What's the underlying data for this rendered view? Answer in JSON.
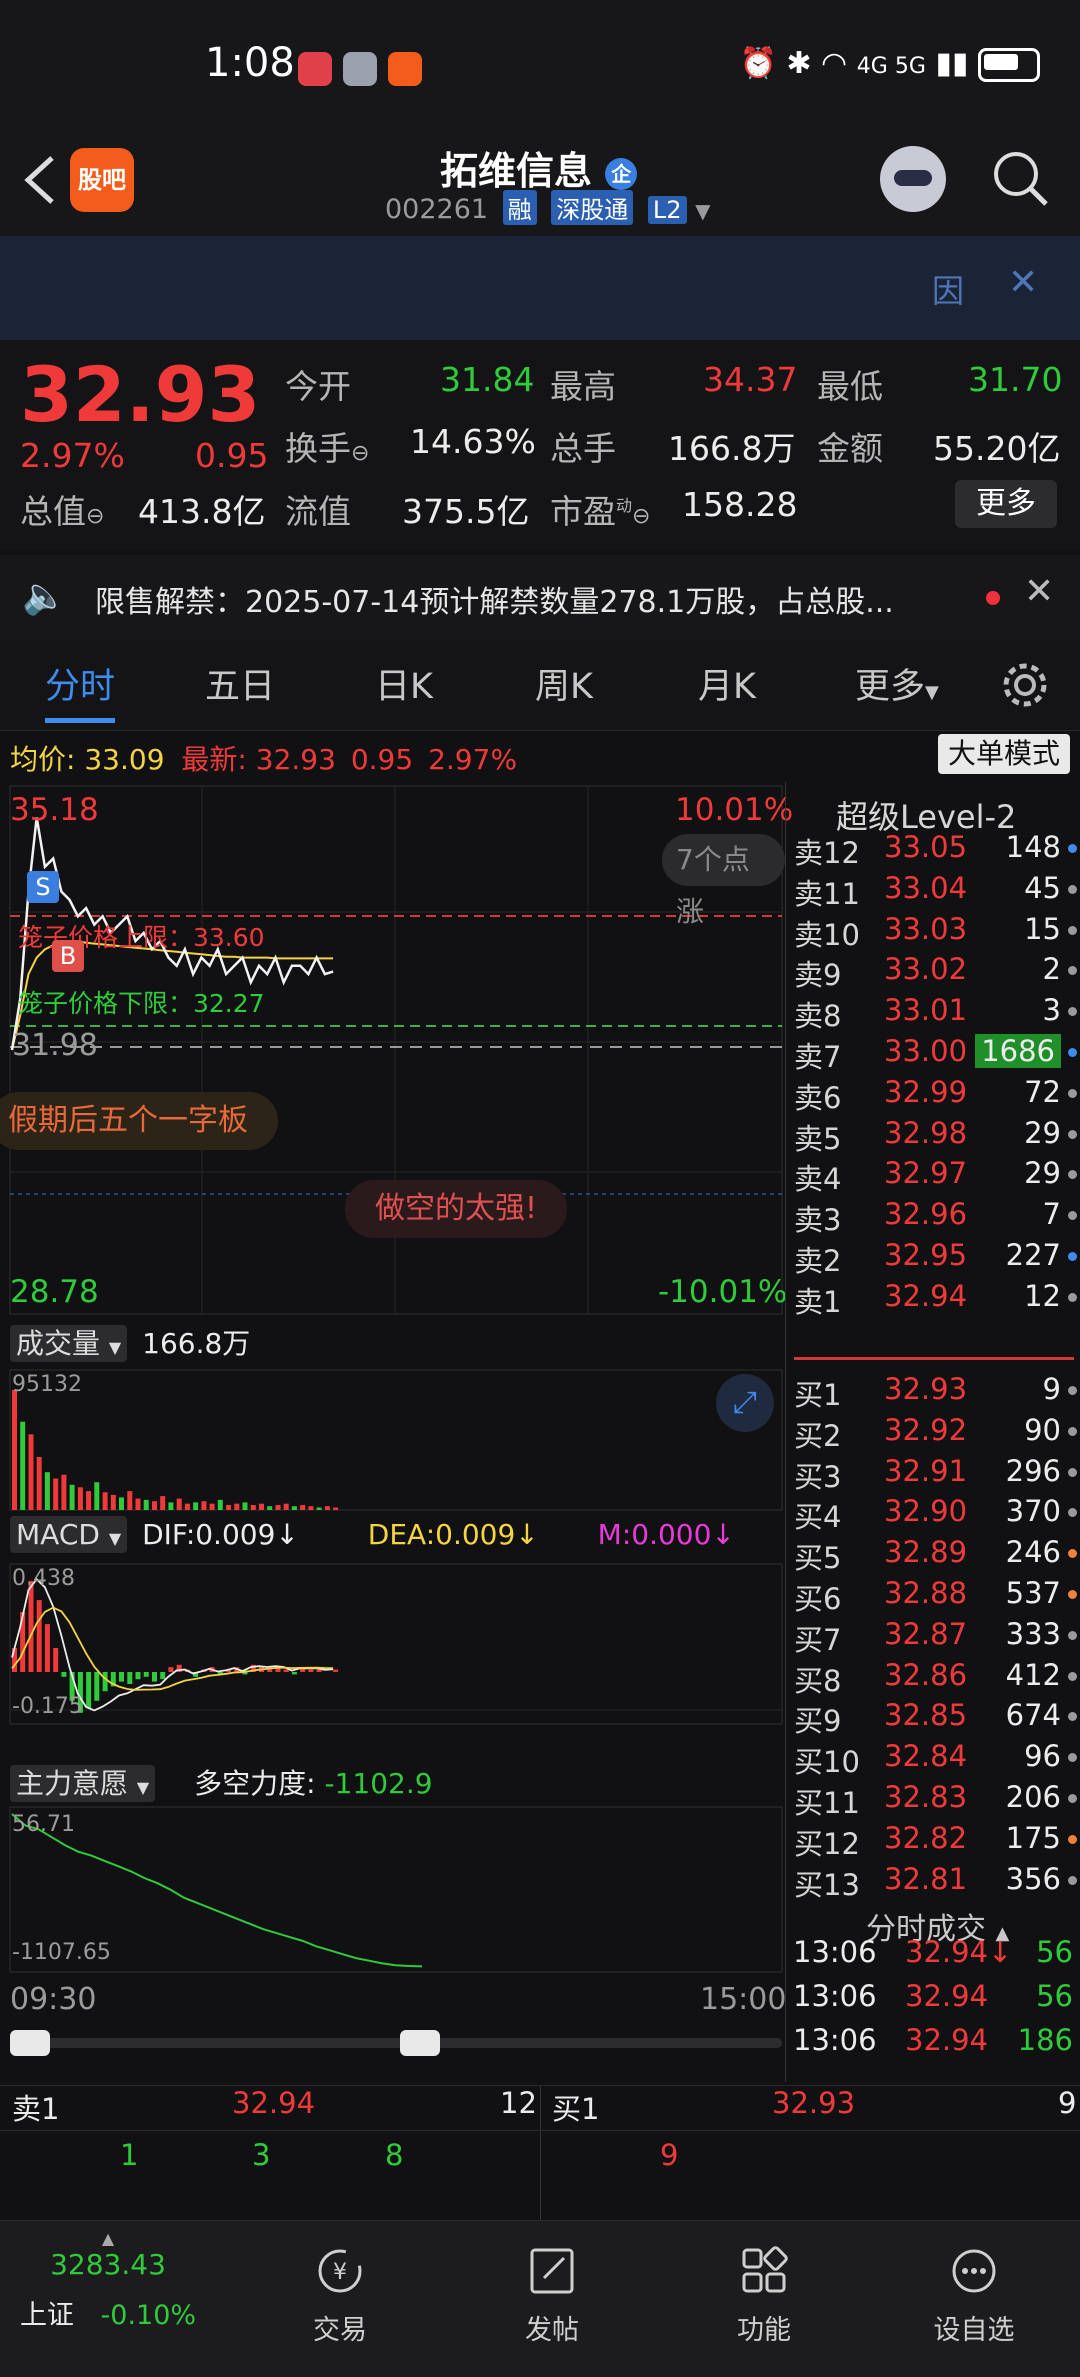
{
  "status_bar": {
    "time": "1:08",
    "network": "4G 5G"
  },
  "header": {
    "title": "拓维信息",
    "code": "002261",
    "tags": [
      "融",
      "深股通",
      "L2"
    ],
    "logo_text": "股吧"
  },
  "banner": {
    "right_char": "因"
  },
  "quote": {
    "price": "32.93",
    "change_pct": "2.97%",
    "change": "0.95",
    "fields": [
      {
        "label": "今开",
        "value": "31.84",
        "color": "green"
      },
      {
        "label": "最高",
        "value": "34.37",
        "color": "red"
      },
      {
        "label": "最低",
        "value": "31.70",
        "color": "green"
      },
      {
        "label": "换手",
        "value": "14.63%",
        "color": "white"
      },
      {
        "label": "总手",
        "value": "166.8万",
        "color": "white"
      },
      {
        "label": "金额",
        "value": "55.20亿",
        "color": "white"
      },
      {
        "label": "总值",
        "value": "413.8亿",
        "color": "white"
      },
      {
        "label": "流值",
        "value": "375.5亿",
        "color": "white"
      },
      {
        "label": "市盈",
        "value": "158.28",
        "color": "white"
      }
    ],
    "pe_superscript": "动",
    "more_label": "更多"
  },
  "notice": {
    "text": "限售解禁：2025-07-14预计解禁数量278.1万股，占总股..."
  },
  "tabs": [
    "分时",
    "五日",
    "日K",
    "周K",
    "月K",
    "更多"
  ],
  "infobar": {
    "avg_label": "均价:",
    "avg_value": "33.09",
    "latest_label": "最新:",
    "latest_value": "32.93",
    "change": "0.95",
    "change_pct": "2.97%",
    "mode_button": "大单模式"
  },
  "chart": {
    "top_price": "35.18",
    "top_pct": "10.01%",
    "bottom_price": "28.78",
    "bottom_pct": "-10.01%",
    "base_price": "31.98",
    "upper_limit_label": "笼子价格上限：33.60",
    "lower_limit_label": "笼子价格下限：32.27",
    "points_label": "7个点涨",
    "bubble1": "假期后五个一字板",
    "bubble2": "做空的太强!",
    "marker_s": "S",
    "marker_b": "B",
    "volume_label": "成交量",
    "volume_total": "166.8万",
    "volume_max": "95132",
    "macd_label": "MACD",
    "dif": "DIF:0.009↓",
    "dea": "DEA:0.009↓",
    "m": "M:0.000↓",
    "macd_top": "0.438",
    "macd_bottom": "-0.175",
    "main_label": "主力意愿",
    "force_label": "多空力度:",
    "force_value": "-1102.9",
    "main_top": "56.71",
    "main_bottom": "-1107.65",
    "time_start": "09:30",
    "time_end": "15:00",
    "price_line": [
      31.98,
      32.6,
      33.9,
      34.8,
      34.2,
      34.3,
      33.9,
      33.8,
      33.6,
      33.7,
      33.5,
      33.6,
      33.4,
      33.5,
      33.6,
      33.3,
      33.4,
      33.2,
      33.3,
      33.1,
      33.0,
      33.2,
      32.9,
      33.1,
      33.0,
      33.2,
      32.9,
      33.0,
      33.1,
      32.8,
      33.0,
      32.9,
      33.1,
      32.8,
      33.0,
      33.0,
      32.9,
      33.1,
      32.9,
      32.93
    ],
    "avg_line": [
      31.98,
      32.4,
      32.9,
      33.1,
      33.2,
      33.25,
      33.28,
      33.3,
      33.3,
      33.28,
      33.27,
      33.26,
      33.25,
      33.24,
      33.23,
      33.22,
      33.21,
      33.2,
      33.19,
      33.18,
      33.17,
      33.16,
      33.15,
      33.14,
      33.13,
      33.12,
      33.11,
      33.11,
      33.1,
      33.1,
      33.1,
      33.1,
      33.09,
      33.09,
      33.09,
      33.09,
      33.09,
      33.09,
      33.09,
      33.09
    ],
    "volumes": [
      95132,
      70000,
      60000,
      42000,
      30000,
      25000,
      28000,
      20000,
      18000,
      15000,
      22000,
      14000,
      12000,
      10000,
      15000,
      9000,
      8000,
      7000,
      11000,
      6000,
      9000,
      5000,
      6000,
      7000,
      5000,
      8000,
      4000,
      5000,
      6000,
      4000,
      5000,
      3000,
      4000,
      5000,
      3000,
      4000,
      3000,
      2000,
      3000,
      2000
    ],
    "macd_bars": [
      0.1,
      0.25,
      0.38,
      0.3,
      0.2,
      0.1,
      -0.02,
      -0.12,
      -0.17,
      -0.15,
      -0.12,
      -0.08,
      -0.06,
      -0.04,
      -0.05,
      -0.03,
      -0.02,
      -0.04,
      -0.03,
      0.02,
      0.03,
      0.01,
      -0.02,
      0.01,
      0.02,
      -0.01,
      0.01,
      0.02,
      -0.01,
      0.03,
      0.02,
      0.01,
      0.02,
      0.01,
      -0.01,
      0.02,
      0.01,
      0.01,
      0.0,
      0.01
    ],
    "force_line": [
      56.71,
      -30,
      -60,
      -120,
      -180,
      -230,
      -260,
      -300,
      -340,
      -380,
      -430,
      -470,
      -520,
      -580,
      -620,
      -660,
      -700,
      -740,
      -780,
      -820,
      -850,
      -880,
      -910,
      -950,
      -980,
      -1010,
      -1040,
      -1060,
      -1080,
      -1095,
      -1100,
      -1102.9
    ]
  },
  "orderbook": {
    "title": "超级Level-2",
    "sell": [
      {
        "label": "卖12",
        "price": "33.05",
        "vol": "148",
        "dot": "blue"
      },
      {
        "label": "卖11",
        "price": "33.04",
        "vol": "45",
        "dot": "gray"
      },
      {
        "label": "卖10",
        "price": "33.03",
        "vol": "15",
        "dot": "gray"
      },
      {
        "label": "卖9",
        "price": "33.02",
        "vol": "2",
        "dot": "gray"
      },
      {
        "label": "卖8",
        "price": "33.01",
        "vol": "3",
        "dot": "gray"
      },
      {
        "label": "卖7",
        "price": "33.00",
        "vol": "1686",
        "dot": "blue",
        "highlight": true
      },
      {
        "label": "卖6",
        "price": "32.99",
        "vol": "72",
        "dot": "gray"
      },
      {
        "label": "卖5",
        "price": "32.98",
        "vol": "29",
        "dot": "gray"
      },
      {
        "label": "卖4",
        "price": "32.97",
        "vol": "29",
        "dot": "gray"
      },
      {
        "label": "卖3",
        "price": "32.96",
        "vol": "7",
        "dot": "gray"
      },
      {
        "label": "卖2",
        "price": "32.95",
        "vol": "227",
        "dot": "blue"
      },
      {
        "label": "卖1",
        "price": "32.94",
        "vol": "12",
        "dot": "gray"
      }
    ],
    "buy": [
      {
        "label": "买1",
        "price": "32.93",
        "vol": "9",
        "dot": "gray"
      },
      {
        "label": "买2",
        "price": "32.92",
        "vol": "90",
        "dot": "gray"
      },
      {
        "label": "买3",
        "price": "32.91",
        "vol": "296",
        "dot": "gray"
      },
      {
        "label": "买4",
        "price": "32.90",
        "vol": "370",
        "dot": "gray"
      },
      {
        "label": "买5",
        "price": "32.89",
        "vol": "246",
        "dot": "orange"
      },
      {
        "label": "买6",
        "price": "32.88",
        "vol": "537",
        "dot": "orange"
      },
      {
        "label": "买7",
        "price": "32.87",
        "vol": "333",
        "dot": "gray"
      },
      {
        "label": "买8",
        "price": "32.86",
        "vol": "412",
        "dot": "gray"
      },
      {
        "label": "买9",
        "price": "32.85",
        "vol": "674",
        "dot": "gray"
      },
      {
        "label": "买10",
        "price": "32.84",
        "vol": "96",
        "dot": "gray"
      },
      {
        "label": "买11",
        "price": "32.83",
        "vol": "206",
        "dot": "gray"
      },
      {
        "label": "买12",
        "price": "32.82",
        "vol": "175",
        "dot": "orange"
      },
      {
        "label": "买13",
        "price": "32.81",
        "vol": "356",
        "dot": "gray"
      }
    ],
    "trades_title": "分时成交",
    "trades": [
      {
        "time": "13:06",
        "price": "32.94↓",
        "vol": "56"
      },
      {
        "time": "13:06",
        "price": "32.94",
        "vol": "56"
      },
      {
        "time": "13:06",
        "price": "32.94",
        "vol": "186"
      }
    ]
  },
  "levelbar": {
    "sell_label": "卖1",
    "sell_price": "32.94",
    "sell_vol": "12",
    "buy_label": "买1",
    "buy_price": "32.93",
    "buy_vol": "9",
    "sell_queue": [
      "1",
      "3",
      "8"
    ],
    "buy_queue": [
      "9"
    ]
  },
  "bottomnav": {
    "index_value": "3283.43",
    "index_name": "上证",
    "index_change": "-0.10%",
    "items": [
      "交易",
      "发帖",
      "功能",
      "设自选"
    ]
  }
}
